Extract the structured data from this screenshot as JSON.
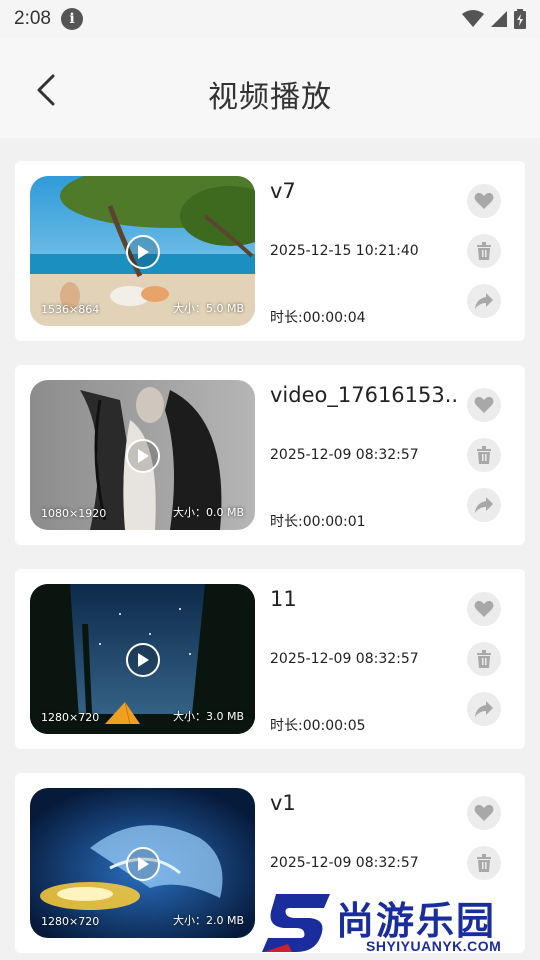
{
  "status_bar": {
    "time": "2:08"
  },
  "header": {
    "title": "视频播放"
  },
  "videos": [
    {
      "name": "v7",
      "date": "2025-12-15 10:21:40",
      "duration": "时长:00:00:04",
      "resolution": "1536×864",
      "size": "大小：5.0 MB"
    },
    {
      "name": "video_17616153..",
      "date": "2025-12-09 08:32:57",
      "duration": "时长:00:00:01",
      "resolution": "1080×1920",
      "size": "大小：0.0 MB"
    },
    {
      "name": "11",
      "date": "2025-12-09 08:32:57",
      "duration": "时长:00:00:05",
      "resolution": "1280×720",
      "size": "大小：3.0 MB"
    },
    {
      "name": "v1",
      "date": "2025-12-09 08:32:57",
      "duration": "",
      "resolution": "1280×720",
      "size": "大小：2.0 MB"
    }
  ],
  "watermark": {
    "brand": "尚游乐园",
    "domain": "SHYIYUANYK.COM"
  },
  "colors": {
    "background": "#f1f1f1",
    "card": "#ffffff",
    "action_bg": "#ececec",
    "action_icon": "#a8a8a8",
    "watermark": "#1a2d9c"
  }
}
